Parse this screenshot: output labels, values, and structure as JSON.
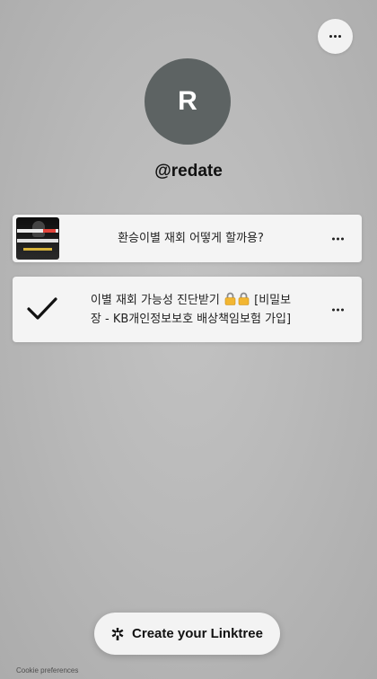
{
  "profile": {
    "initial": "R",
    "username": "@redate"
  },
  "links": [
    {
      "title": "환승이별 재회 어떻게 할까용?"
    },
    {
      "title_line1": "이별 재회 가능성 진단받기",
      "title_line1_tail": "[비밀보",
      "title_line2": "장 - KB개인정보보호 배상책임보험 가입]"
    }
  ],
  "cta": {
    "label": "Create your Linktree"
  },
  "footer": {
    "cookie_label": "Cookie preferences"
  },
  "icons": {
    "menu": "more-horizontal-icon",
    "check": "checkmark-icon",
    "lock": "lock-emoji-icon",
    "linktree": "linktree-asterisk-icon"
  },
  "colors": {
    "avatar_bg": "#5d6363",
    "card_bg": "#f4f4f4",
    "page_bg": "#bdbdbd"
  }
}
